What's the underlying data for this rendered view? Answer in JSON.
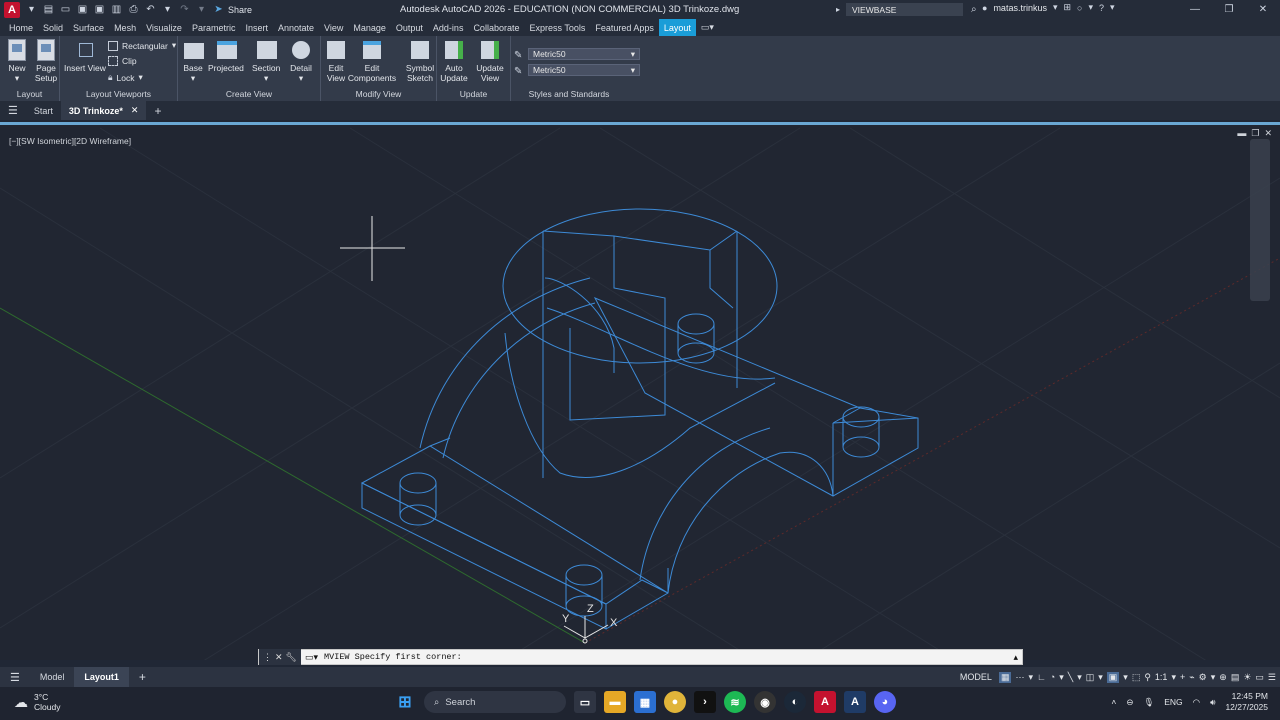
{
  "app": {
    "title": "Autodesk AutoCAD 2026 - EDUCATION (NON COMMERCIAL)   3D Trinkoze.dwg",
    "logo": "A",
    "share_label": "Share",
    "search_value": "VIEWBASE",
    "user": "matas.trinkus"
  },
  "menu_tabs": [
    "Home",
    "Solid",
    "Surface",
    "Mesh",
    "Visualize",
    "Parametric",
    "Insert",
    "Annotate",
    "View",
    "Manage",
    "Output",
    "Add-ins",
    "Collaborate",
    "Express Tools",
    "Featured Apps",
    "Layout"
  ],
  "active_menu_tab": "Layout",
  "ribbon": {
    "layout_panel": {
      "title": "Layout",
      "new": "New",
      "page_setup": "Page Setup"
    },
    "viewports_panel": {
      "title": "Layout Viewports",
      "insert_view": "Insert View",
      "rectangular": "Rectangular",
      "clip": "Clip",
      "lock": "Lock"
    },
    "create_view_panel": {
      "title": "Create View",
      "base": "Base",
      "projected": "Projected",
      "section": "Section",
      "detail": "Detail"
    },
    "modify_view_panel": {
      "title": "Modify View",
      "edit_view": "Edit View",
      "edit_components": "Edit Components",
      "symbol_sketch": "Symbol Sketch"
    },
    "update_panel": {
      "title": "Update",
      "auto_update": "Auto Update",
      "update_view": "Update View"
    },
    "styles_panel": {
      "title": "Styles and Standards",
      "style1": "Metric50",
      "style2": "Metric50"
    }
  },
  "file_tabs": {
    "start": "Start",
    "drawing": "3D Trinkoze*"
  },
  "viewport": {
    "label": "[−][SW Isometric][2D Wireframe]",
    "ucs_x": "X",
    "ucs_y": "Y",
    "ucs_z": "Z"
  },
  "command_line": {
    "text": "MVIEW Specify first corner:"
  },
  "layout_tabs": {
    "model": "Model",
    "layout1": "Layout1"
  },
  "status": {
    "space": "MODEL",
    "scale": "1:1"
  },
  "taskbar": {
    "temp": "3°C",
    "weather": "Cloudy",
    "search_placeholder": "Search",
    "lang": "ENG",
    "time": "12:45 PM",
    "date": "12/27/2025"
  }
}
